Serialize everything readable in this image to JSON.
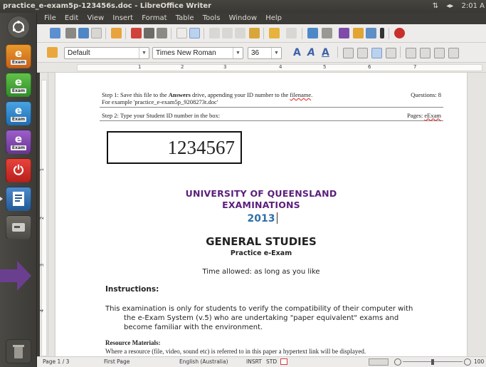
{
  "window": {
    "title": "practice_e-exam5p-123456s.doc - LibreOffice Writer",
    "tray_network": "⇅",
    "tray_volume": "◂▸",
    "tray_time": "2:01 A"
  },
  "menu": [
    "File",
    "Edit",
    "View",
    "Insert",
    "Format",
    "Table",
    "Tools",
    "Window",
    "Help"
  ],
  "launcher": [
    {
      "name": "ubuntu-dash-icon",
      "big": "",
      "small": ""
    },
    {
      "name": "exam-app-1-icon",
      "big": "e",
      "small": "Exam"
    },
    {
      "name": "exam-app-2-icon",
      "big": "e",
      "small": "Exam"
    },
    {
      "name": "exam-app-3-icon",
      "big": "e",
      "small": "Exam"
    },
    {
      "name": "exam-app-4-icon",
      "big": "e",
      "small": "Exam"
    },
    {
      "name": "shutdown-icon",
      "big": "⏻",
      "small": ""
    },
    {
      "name": "writer-icon",
      "big": "",
      "small": ""
    },
    {
      "name": "drive-icon",
      "big": "",
      "small": ""
    },
    {
      "name": "trash-icon",
      "big": "",
      "small": ""
    }
  ],
  "format_toolbar": {
    "style": "Default",
    "font": "Times New Roman",
    "size": "36"
  },
  "ruler_numbers": [
    "1",
    "2",
    "3",
    "4",
    "5",
    "6",
    "7"
  ],
  "vruler_numbers": [
    "1",
    "2",
    "3",
    "4"
  ],
  "document": {
    "step1_prefix": "Step 1: Save this file to the ",
    "step1_bold": "Answers",
    "step1_suffix": " drive, appending your ID number to the ",
    "step1_filename": "filename",
    "step1_end": ".",
    "step1_example": "For example 'practice_e-exam5p_9208273t.doc'",
    "questions": "Questions: 8",
    "step2": "Step 2: Type your Student ID number in the box:",
    "pages_label": "Pages: ",
    "pages_value": "eExam",
    "student_id": "1234567",
    "university_line1": "UNIVERSITY OF QUEENSLAND",
    "university_line2": "EXAMINATIONS",
    "year": "2013",
    "subject": "GENERAL STUDIES",
    "subtitle": "Practice e-Exam",
    "time_allowed": "Time allowed:  as long as you like",
    "instructions_heading": "Instructions:",
    "instructions_line1": "This examination is only for students to verify the compatibility of their computer with",
    "instructions_line2": "the e-Exam System (v.5) who are undertaking \"paper equivalent\" exams and",
    "instructions_line3": "become familiar with the environment.",
    "resource_heading": "Resource Materials:",
    "resource_text": "Where a resource (file, video, sound etc) is referred to in this paper a hypertext link will be displayed."
  },
  "status": {
    "page": "Page 1 / 3",
    "page_style": "First Page",
    "language": "English (Australia)",
    "insert": "INSRT",
    "selection": "STD",
    "zoom": "100"
  },
  "colors": {
    "university": "#5b1e7b",
    "year": "#2f6fa8",
    "arrow": "#6b3f8f"
  }
}
